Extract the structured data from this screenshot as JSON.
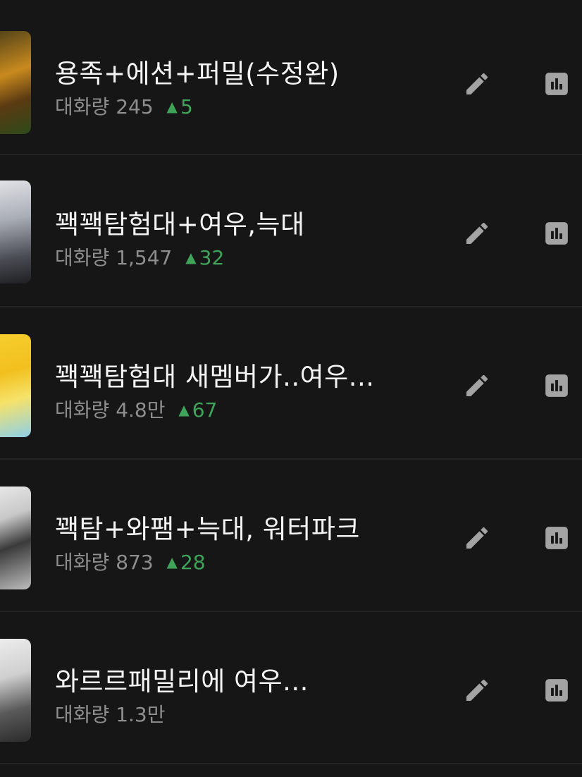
{
  "items": [
    {
      "title": "용족+에션+퍼밀(수정완)",
      "stat_label": "대화량",
      "count": "245",
      "delta": "5",
      "thumb_colors": [
        "#5a4a1a",
        "#d08a1c",
        "#2f5a1e"
      ]
    },
    {
      "title": "꽥꽥탐험대+여우,늑대",
      "stat_label": "대화량",
      "count": "1,547",
      "delta": "32",
      "thumb_colors": [
        "#d8d8dc",
        "#8a8d96",
        "#2a2a2e"
      ]
    },
    {
      "title": "꽥꽥탐험대 새멤버가..여우...",
      "stat_label": "대화량",
      "count": "4.8만",
      "delta": "67",
      "thumb_colors": [
        "#f2c01e",
        "#f6e26a",
        "#8ed0e8"
      ]
    },
    {
      "title": "꽥탐+와팸+늑대, 워터파크",
      "stat_label": "대화량",
      "count": "873",
      "delta": "28",
      "thumb_colors": [
        "#e6e6e6",
        "#3a3a3a",
        "#bdbdbd"
      ]
    },
    {
      "title": "와르르패밀리에 여우...",
      "stat_label": "대화량",
      "count": "1.3만",
      "delta": "",
      "thumb_colors": [
        "#ececec",
        "#9a9a9a",
        "#2b2b2b"
      ]
    }
  ],
  "icons": {
    "edit": "pencil-icon",
    "stats": "bar-chart-icon",
    "delta": "up-triangle-icon"
  },
  "colors": {
    "background": "#161616",
    "delta_green": "#3fa45a",
    "icon_gray": "#a3a3a3"
  }
}
